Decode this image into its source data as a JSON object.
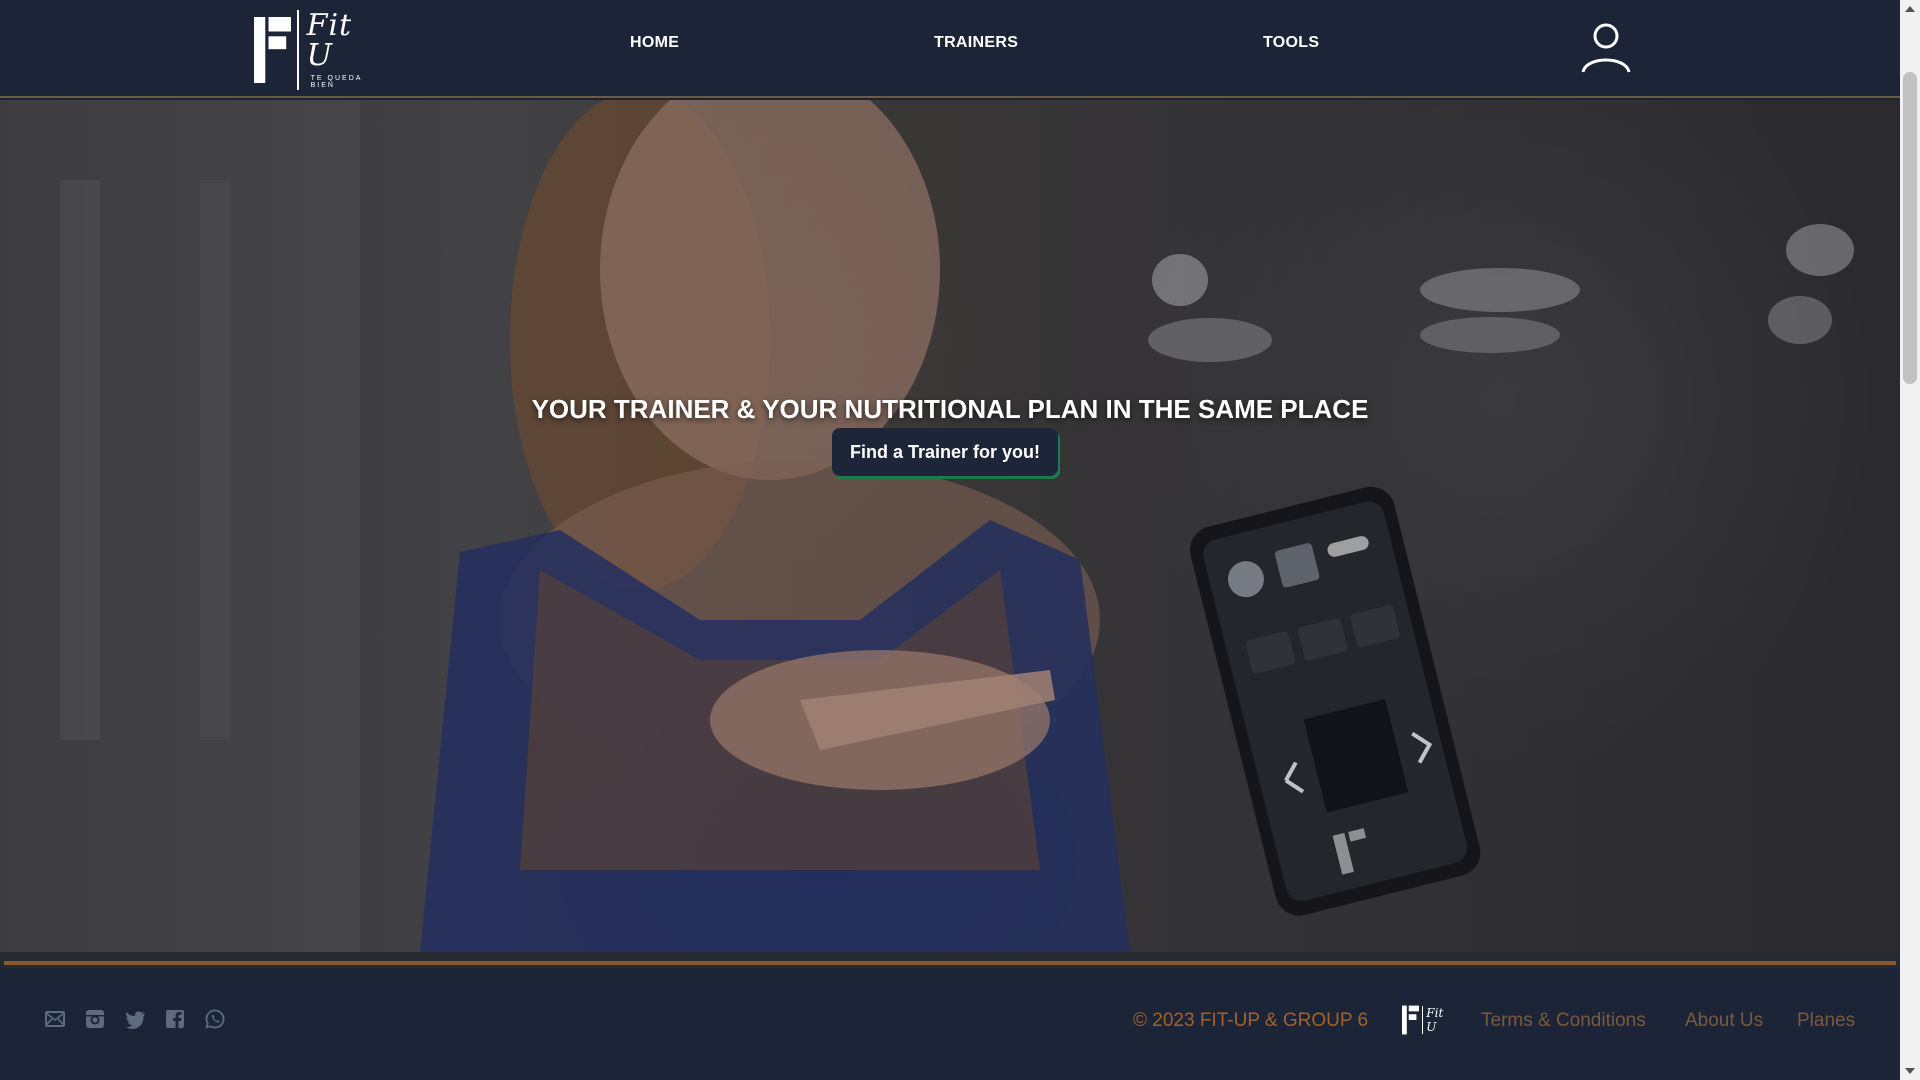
{
  "header": {
    "logo": {
      "script": "Fit U",
      "tagline": "TE QUEDA BIEN"
    },
    "nav": [
      {
        "label": "HOME"
      },
      {
        "label": "TRAINERS"
      },
      {
        "label": "TOOLS"
      }
    ]
  },
  "hero": {
    "title": "YOUR TRAINER & YOUR NUTRITIONAL PLAN IN THE SAME PLACE",
    "cta_label": "Find a Trainer for you!"
  },
  "footer": {
    "social_icons": [
      "mail-icon",
      "instagram-icon",
      "twitter-icon",
      "facebook-icon",
      "whatsapp-icon"
    ],
    "copyright": "© 2023 FIT-UP & GROUP 6",
    "logo_script": "Fit U",
    "links": [
      {
        "label": "Terms & Conditions"
      },
      {
        "label": "About Us"
      },
      {
        "label": "Planes"
      }
    ]
  },
  "colors": {
    "header_bg": "#1c2537",
    "accent_orange": "#a3612a",
    "footer_link": "#7a5a3e",
    "button_bg": "#1d2638",
    "button_shadow": "#1f7a4a"
  }
}
